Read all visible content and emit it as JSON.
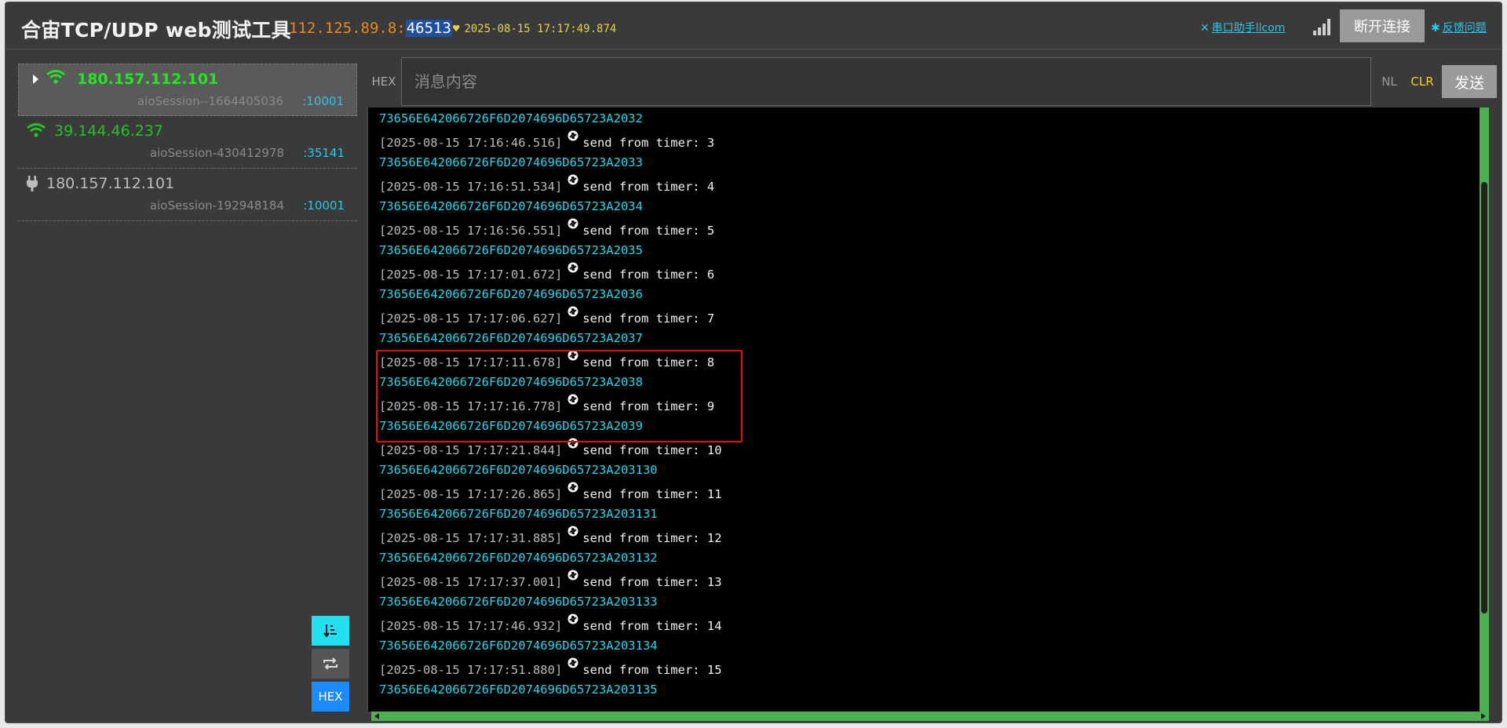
{
  "header": {
    "title": "合宙TCP/UDP web测试工具",
    "address_host": "112.125.89.8:",
    "address_port": "46513",
    "clock": "2025-08-15 17:17:49.874",
    "serial_link": "串口助手llcom",
    "disconnect_label": "断开连接",
    "feedback_link": "反馈问题"
  },
  "sidebar": {
    "sessions": [
      {
        "ip": "180.157.112.101",
        "name": "aioSession--1664405036",
        "port": ":10001",
        "status": "connected-active",
        "color": "#22e622"
      },
      {
        "ip": "39.144.46.237",
        "name": "aioSession-430412978",
        "port": ":35141",
        "status": "connected",
        "color": "#22c322"
      },
      {
        "ip": "180.157.112.101",
        "name": "aioSession-192948184",
        "port": ":10001",
        "status": "disconnected",
        "color": "#bdbdbd"
      }
    ],
    "buttons": {
      "sort_icon": "sort-desc-icon",
      "repeat_icon": "repeat-icon",
      "hex_label": "HEX"
    }
  },
  "toolbar": {
    "hex_label": "HEX",
    "message_placeholder": "消息内容",
    "message_value": "",
    "nl_label": "NL",
    "clr_label": "CLR",
    "send_label": "发送"
  },
  "log": {
    "lines": [
      {
        "kind": "hex",
        "text": "73656E642066726F6D2074696D65723A2032"
      },
      {
        "kind": "msg",
        "ts": "[2025-08-15 17:16:46.516]",
        "text": "send from timer: 3"
      },
      {
        "kind": "hex",
        "text": "73656E642066726F6D2074696D65723A2033"
      },
      {
        "kind": "msg",
        "ts": "[2025-08-15 17:16:51.534]",
        "text": "send from timer: 4"
      },
      {
        "kind": "hex",
        "text": "73656E642066726F6D2074696D65723A2034"
      },
      {
        "kind": "msg",
        "ts": "[2025-08-15 17:16:56.551]",
        "text": "send from timer: 5"
      },
      {
        "kind": "hex",
        "text": "73656E642066726F6D2074696D65723A2035"
      },
      {
        "kind": "msg",
        "ts": "[2025-08-15 17:17:01.672]",
        "text": "send from timer: 6"
      },
      {
        "kind": "hex",
        "text": "73656E642066726F6D2074696D65723A2036"
      },
      {
        "kind": "msg",
        "ts": "[2025-08-15 17:17:06.627]",
        "text": "send from timer: 7"
      },
      {
        "kind": "hex",
        "text": "73656E642066726F6D2074696D65723A2037"
      },
      {
        "kind": "msg",
        "ts": "[2025-08-15 17:17:11.678]",
        "text": "send from timer: 8"
      },
      {
        "kind": "hex",
        "text": "73656E642066726F6D2074696D65723A2038"
      },
      {
        "kind": "msg",
        "ts": "[2025-08-15 17:17:16.778]",
        "text": "send from timer: 9"
      },
      {
        "kind": "hex",
        "text": "73656E642066726F6D2074696D65723A2039"
      },
      {
        "kind": "msg",
        "ts": "[2025-08-15 17:17:21.844]",
        "text": "send from timer: 10"
      },
      {
        "kind": "hex",
        "text": "73656E642066726F6D2074696D65723A203130"
      },
      {
        "kind": "msg",
        "ts": "[2025-08-15 17:17:26.865]",
        "text": "send from timer: 11"
      },
      {
        "kind": "hex",
        "text": "73656E642066726F6D2074696D65723A203131"
      },
      {
        "kind": "msg",
        "ts": "[2025-08-15 17:17:31.885]",
        "text": "send from timer: 12"
      },
      {
        "kind": "hex",
        "text": "73656E642066726F6D2074696D65723A203132"
      },
      {
        "kind": "msg",
        "ts": "[2025-08-15 17:17:37.001]",
        "text": "send from timer: 13"
      },
      {
        "kind": "hex",
        "text": "73656E642066726F6D2074696D65723A203133"
      },
      {
        "kind": "msg",
        "ts": "[2025-08-15 17:17:46.932]",
        "text": "send from timer: 14"
      },
      {
        "kind": "hex",
        "text": "73656E642066726F6D2074696D65723A203134"
      },
      {
        "kind": "msg",
        "ts": "[2025-08-15 17:17:51.880]",
        "text": "send from timer: 15"
      },
      {
        "kind": "hex",
        "text": "73656E642066726F6D2074696D65723A203135"
      }
    ]
  },
  "colors": {
    "accent_cyan": "#27c7e8",
    "hex_text": "#1fd6ee",
    "address": "#e88a1a",
    "clock": "#e3d44a",
    "highlight_box": "#e01010",
    "scrollbar": "#4caf50"
  }
}
